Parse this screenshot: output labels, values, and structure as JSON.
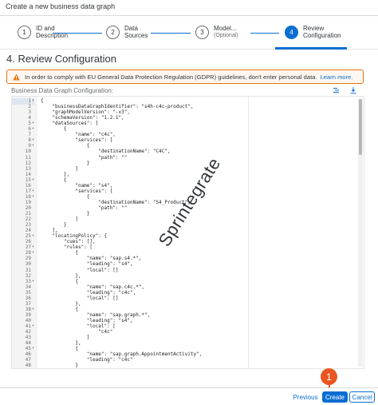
{
  "dialog_title": "Create a new business data graph",
  "wizard": {
    "steps": [
      {
        "number": "1",
        "label_line1": "ID and",
        "label_line2": "Description",
        "sub": ""
      },
      {
        "number": "2",
        "label_line1": "Data",
        "label_line2": "Sources",
        "sub": ""
      },
      {
        "number": "3",
        "label_line1": "Model...",
        "label_line2": "",
        "sub": "(Optional)"
      },
      {
        "number": "4",
        "label_line1": "Review",
        "label_line2": "Configuration",
        "sub": ""
      }
    ]
  },
  "section_title": "4. Review Configuration",
  "warning": {
    "text": "In order to comply with EU General Data Protection Regulation (GDPR) guidelines, don't enter personal data.",
    "link": "Learn more."
  },
  "config_label": "Business Data Graph Configuration:",
  "editor": {
    "lines": [
      {
        "n": "1",
        "fold": "▾",
        "code": "{"
      },
      {
        "n": "2",
        "fold": "",
        "code": "    \"businessDataGraphIdentifier\": \"s4h-c4c-product\","
      },
      {
        "n": "3",
        "fold": "",
        "code": "    \"graphModelVersion\": \"-v3\","
      },
      {
        "n": "4",
        "fold": "",
        "code": "    \"schemaVersion\": \"1.2.1\","
      },
      {
        "n": "5",
        "fold": "▾",
        "code": "    \"dataSources\": ["
      },
      {
        "n": "6",
        "fold": "▾",
        "code": "        {"
      },
      {
        "n": "7",
        "fold": "",
        "code": "            \"name\": \"c4c\","
      },
      {
        "n": "8",
        "fold": "▾",
        "code": "            \"services\": ["
      },
      {
        "n": "9",
        "fold": "▾",
        "code": "                {"
      },
      {
        "n": "10",
        "fold": "",
        "code": "                    \"destinationName\": \"C4C\","
      },
      {
        "n": "11",
        "fold": "",
        "code": "                    \"path\": \"\""
      },
      {
        "n": "12",
        "fold": "",
        "code": "                }"
      },
      {
        "n": "13",
        "fold": "",
        "code": "            ]"
      },
      {
        "n": "14",
        "fold": "",
        "code": "        },"
      },
      {
        "n": "15",
        "fold": "▾",
        "code": "        {"
      },
      {
        "n": "16",
        "fold": "",
        "code": "            \"name\": \"s4\","
      },
      {
        "n": "17",
        "fold": "▾",
        "code": "            \"services\": ["
      },
      {
        "n": "18",
        "fold": "▾",
        "code": "                {"
      },
      {
        "n": "19",
        "fold": "",
        "code": "                    \"destinationName\": \"S4_Product\","
      },
      {
        "n": "20",
        "fold": "",
        "code": "                    \"path\": \"\""
      },
      {
        "n": "21",
        "fold": "",
        "code": "                }"
      },
      {
        "n": "22",
        "fold": "",
        "code": "            ]"
      },
      {
        "n": "23",
        "fold": "",
        "code": "        }"
      },
      {
        "n": "24",
        "fold": "",
        "code": "    ],"
      },
      {
        "n": "25",
        "fold": "▾",
        "code": "    \"locatingPolicy\": {"
      },
      {
        "n": "26",
        "fold": "",
        "code": "        \"cues\": [],"
      },
      {
        "n": "27",
        "fold": "▾",
        "code": "        \"rules\": ["
      },
      {
        "n": "28",
        "fold": "▾",
        "code": "            {"
      },
      {
        "n": "29",
        "fold": "",
        "code": "                \"name\": \"sap.s4.*\","
      },
      {
        "n": "30",
        "fold": "",
        "code": "                \"leading\": \"s4\","
      },
      {
        "n": "31",
        "fold": "",
        "code": "                \"local\": []"
      },
      {
        "n": "32",
        "fold": "",
        "code": "            },"
      },
      {
        "n": "33",
        "fold": "▾",
        "code": "            {"
      },
      {
        "n": "34",
        "fold": "",
        "code": "                \"name\": \"sap.c4c.*\","
      },
      {
        "n": "35",
        "fold": "",
        "code": "                \"leading\": \"c4c\","
      },
      {
        "n": "36",
        "fold": "",
        "code": "                \"local\": []"
      },
      {
        "n": "37",
        "fold": "",
        "code": "            },"
      },
      {
        "n": "38",
        "fold": "▾",
        "code": "            {"
      },
      {
        "n": "39",
        "fold": "",
        "code": "                \"name\": \"sap.graph.*\","
      },
      {
        "n": "40",
        "fold": "",
        "code": "                \"leading\": \"s4\","
      },
      {
        "n": "41",
        "fold": "▾",
        "code": "                \"local\": ["
      },
      {
        "n": "42",
        "fold": "",
        "code": "                    \"c4c\""
      },
      {
        "n": "43",
        "fold": "",
        "code": "                ]"
      },
      {
        "n": "44",
        "fold": "",
        "code": "            },"
      },
      {
        "n": "45",
        "fold": "▾",
        "code": "            {"
      },
      {
        "n": "46",
        "fold": "",
        "code": "                \"name\": \"sap.graph.AppointmentActivity\","
      },
      {
        "n": "47",
        "fold": "",
        "code": "                \"leading\": \"c4c\""
      },
      {
        "n": "48",
        "fold": "",
        "code": "            }"
      }
    ]
  },
  "watermark": "Sprintegrate",
  "footer": {
    "previous": "Previous",
    "create": "Create",
    "cancel": "Cancel"
  },
  "callout_badge": "1",
  "colors": {
    "accent": "#0a6ed1",
    "warning": "#e9730c",
    "callout": "#e9561f"
  },
  "icons": {
    "warning": "warning-icon",
    "format": "format-icon",
    "download": "download-icon"
  }
}
